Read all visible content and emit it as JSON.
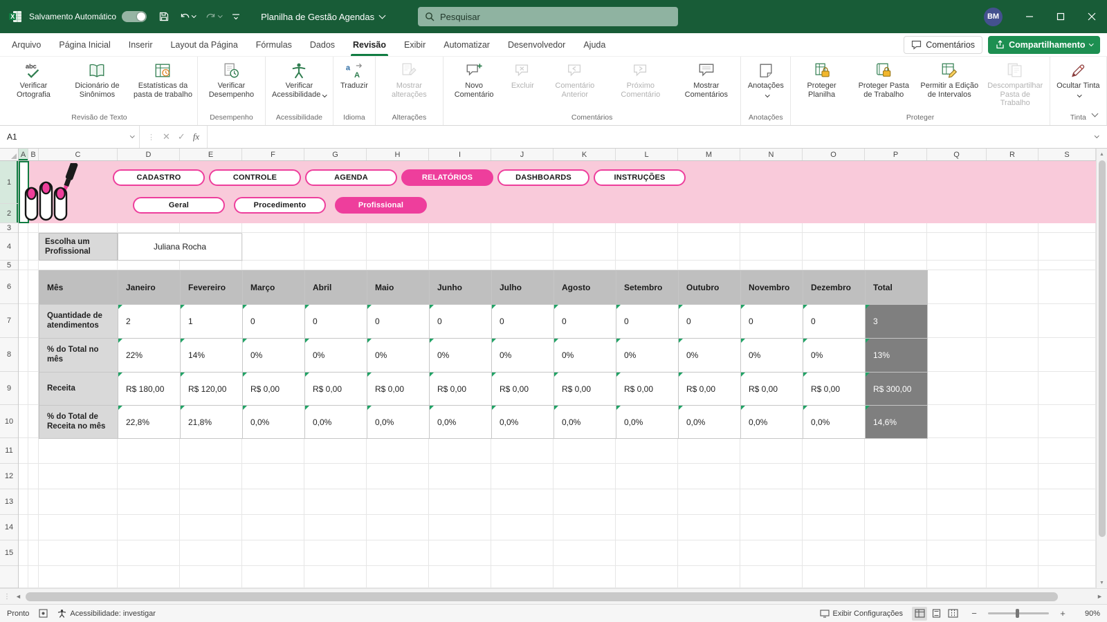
{
  "colors": {
    "title_green": "#185c37",
    "accent_green": "#107c41",
    "share_green": "#1d8f51",
    "search_green": "#8fb3a1",
    "banner_pink": "#f9cada",
    "pill_pink": "#ee3e9c",
    "table_header_gray": "#bfbfbf",
    "label_gray": "#d9d9d9",
    "total_gray": "#7f7f7f",
    "marker_green": "#21a366",
    "avatar_blue": "#44518f"
  },
  "title_bar": {
    "autosave_label": "Salvamento Automático",
    "doc_title": "Planilha de Gestão Agendas",
    "search_placeholder": "Pesquisar",
    "avatar_initials": "BM"
  },
  "menu_bar": {
    "tabs": [
      {
        "label": "Arquivo"
      },
      {
        "label": "Página Inicial"
      },
      {
        "label": "Inserir"
      },
      {
        "label": "Layout da Página"
      },
      {
        "label": "Fórmulas"
      },
      {
        "label": "Dados"
      },
      {
        "label": "Revisão",
        "active": true
      },
      {
        "label": "Exibir"
      },
      {
        "label": "Automatizar"
      },
      {
        "label": "Desenvolvedor"
      },
      {
        "label": "Ajuda"
      }
    ],
    "comments_label": "Comentários",
    "share_label": "Compartilhamento"
  },
  "ribbon": {
    "groups": [
      {
        "name": "Revisão de Texto",
        "buttons": [
          {
            "label": "Verificar Ortografia",
            "icon": "spelling-icon"
          },
          {
            "label": "Dicionário de Sinônimos",
            "icon": "thesaurus-icon"
          },
          {
            "label": "Estatísticas da pasta de trabalho",
            "icon": "workbook-stats-icon"
          }
        ]
      },
      {
        "name": "Desempenho",
        "buttons": [
          {
            "label": "Verificar Desempenho",
            "icon": "performance-icon"
          }
        ]
      },
      {
        "name": "Acessibilidade",
        "buttons": [
          {
            "label": "Verificar Acessibilidade",
            "icon": "accessibility-icon",
            "menu": true
          }
        ]
      },
      {
        "name": "Idioma",
        "buttons": [
          {
            "label": "Traduzir",
            "icon": "translate-icon"
          }
        ]
      },
      {
        "name": "Alterações",
        "buttons": [
          {
            "label": "Mostrar alterações",
            "icon": "changes-icon",
            "disabled": true
          }
        ]
      },
      {
        "name": "Comentários",
        "buttons": [
          {
            "label": "Novo Comentário",
            "icon": "new-comment-icon"
          },
          {
            "label": "Excluir",
            "icon": "delete-comment-icon",
            "disabled": true
          },
          {
            "label": "Comentário Anterior",
            "icon": "previous-comment-icon",
            "disabled": true
          },
          {
            "label": "Próximo Comentário",
            "icon": "next-comment-icon",
            "disabled": true
          },
          {
            "label": "Mostrar Comentários",
            "icon": "show-comments-icon"
          }
        ]
      },
      {
        "name": "Anotações",
        "buttons": [
          {
            "label": "Anotações",
            "icon": "notes-icon",
            "menu": true
          }
        ]
      },
      {
        "name": "Proteger",
        "buttons": [
          {
            "label": "Proteger Planilha",
            "icon": "protect-sheet-icon"
          },
          {
            "label": "Proteger Pasta de Trabalho",
            "icon": "protect-workbook-icon"
          },
          {
            "label": "Permitir a Edição de Intervalos",
            "icon": "allow-edit-ranges-icon"
          },
          {
            "label": "Descompartilhar Pasta de Trabalho",
            "icon": "unshare-workbook-icon",
            "disabled": true
          }
        ]
      },
      {
        "name": "Tinta",
        "buttons": [
          {
            "label": "Ocultar Tinta",
            "icon": "hide-ink-icon",
            "menu": true
          }
        ]
      }
    ]
  },
  "formula_bar": {
    "name_box": "A1",
    "fx_label": "fx",
    "formula": ""
  },
  "sheet": {
    "columns": [
      "A",
      "B",
      "C",
      "D",
      "E",
      "F",
      "G",
      "H",
      "I",
      "J",
      "K",
      "L",
      "M",
      "N",
      "O",
      "P",
      "Q",
      "R",
      "S"
    ],
    "rows": [
      "1",
      "2",
      "3",
      "4",
      "5",
      "6",
      "7",
      "8",
      "9",
      "10",
      "11",
      "12",
      "13",
      "14",
      "15"
    ],
    "active_cell": "A1",
    "banner": {
      "nav_pills": [
        {
          "label": "CADASTRO"
        },
        {
          "label": "CONTROLE"
        },
        {
          "label": "AGENDA"
        },
        {
          "label": "RELATÓRIOS",
          "active": true
        },
        {
          "label": "DASHBOARDS"
        },
        {
          "label": "INSTRUÇÕES"
        }
      ],
      "sub_pills": [
        {
          "label": "Geral"
        },
        {
          "label": "Procedimento"
        },
        {
          "label": "Profissional",
          "active": true
        }
      ]
    },
    "selector": {
      "label": "Escolha um Profissional",
      "value": "Juliana Rocha"
    },
    "table": {
      "columns": [
        "Mês",
        "Janeiro",
        "Fevereiro",
        "Março",
        "Abril",
        "Maio",
        "Junho",
        "Julho",
        "Agosto",
        "Setembro",
        "Outubro",
        "Novembro",
        "Dezembro",
        "Total"
      ],
      "rows": [
        {
          "label": "Quantidade de atendimentos",
          "values": [
            "2",
            "1",
            "0",
            "0",
            "0",
            "0",
            "0",
            "0",
            "0",
            "0",
            "0",
            "0"
          ],
          "total": "3"
        },
        {
          "label": "% do Total  no mês",
          "values": [
            "22%",
            "14%",
            "0%",
            "0%",
            "0%",
            "0%",
            "0%",
            "0%",
            "0%",
            "0%",
            "0%",
            "0%"
          ],
          "total": "13%"
        },
        {
          "label": "Receita",
          "values": [
            "R$ 180,00",
            "R$ 120,00",
            "R$ 0,00",
            "R$ 0,00",
            "R$ 0,00",
            "R$ 0,00",
            "R$ 0,00",
            "R$ 0,00",
            "R$ 0,00",
            "R$ 0,00",
            "R$ 0,00",
            "R$ 0,00"
          ],
          "total": "R$ 300,00"
        },
        {
          "label": "% do Total de Receita no mês",
          "values": [
            "22,8%",
            "21,8%",
            "0,0%",
            "0,0%",
            "0,0%",
            "0,0%",
            "0,0%",
            "0,0%",
            "0,0%",
            "0,0%",
            "0,0%",
            "0,0%"
          ],
          "total": "14,6%"
        }
      ]
    }
  },
  "status_bar": {
    "mode": "Pronto",
    "accessibility": "Acessibilidade: investigar",
    "display_settings": "Exibir Configurações",
    "zoom": "90%"
  }
}
